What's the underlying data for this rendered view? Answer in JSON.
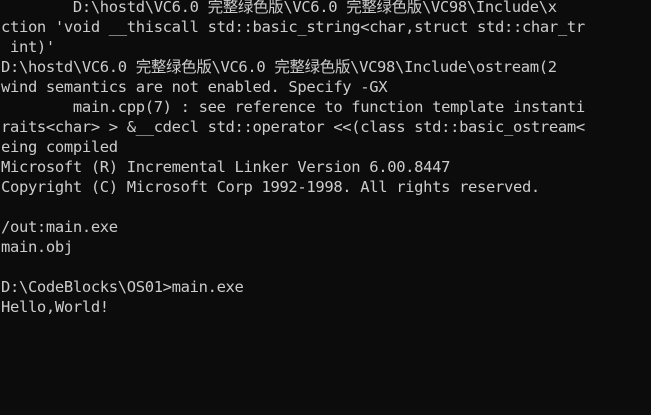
{
  "console": {
    "lines": [
      "        D:\\hostd\\VC6.0 完整绿色版\\VC6.0 完整绿色版\\VC98\\Include\\x",
      "ction 'void __thiscall std::basic_string<char,struct std::char_tr",
      " int)'",
      "D:\\hostd\\VC6.0 完整绿色版\\VC6.0 完整绿色版\\VC98\\Include\\ostream(2",
      "wind semantics are not enabled. Specify -GX",
      "        main.cpp(7) : see reference to function template instanti",
      "raits<char> > &__cdecl std::operator <<(class std::basic_ostream<",
      "eing compiled",
      "Microsoft (R) Incremental Linker Version 6.00.8447",
      "Copyright (C) Microsoft Corp 1992-1998. All rights reserved.",
      "",
      "/out:main.exe",
      "main.obj",
      "",
      "D:\\CodeBlocks\\OS01>main.exe",
      "Hello,World!"
    ]
  },
  "colors": {
    "background": "#0c0c0c",
    "text": "#cccccc"
  }
}
